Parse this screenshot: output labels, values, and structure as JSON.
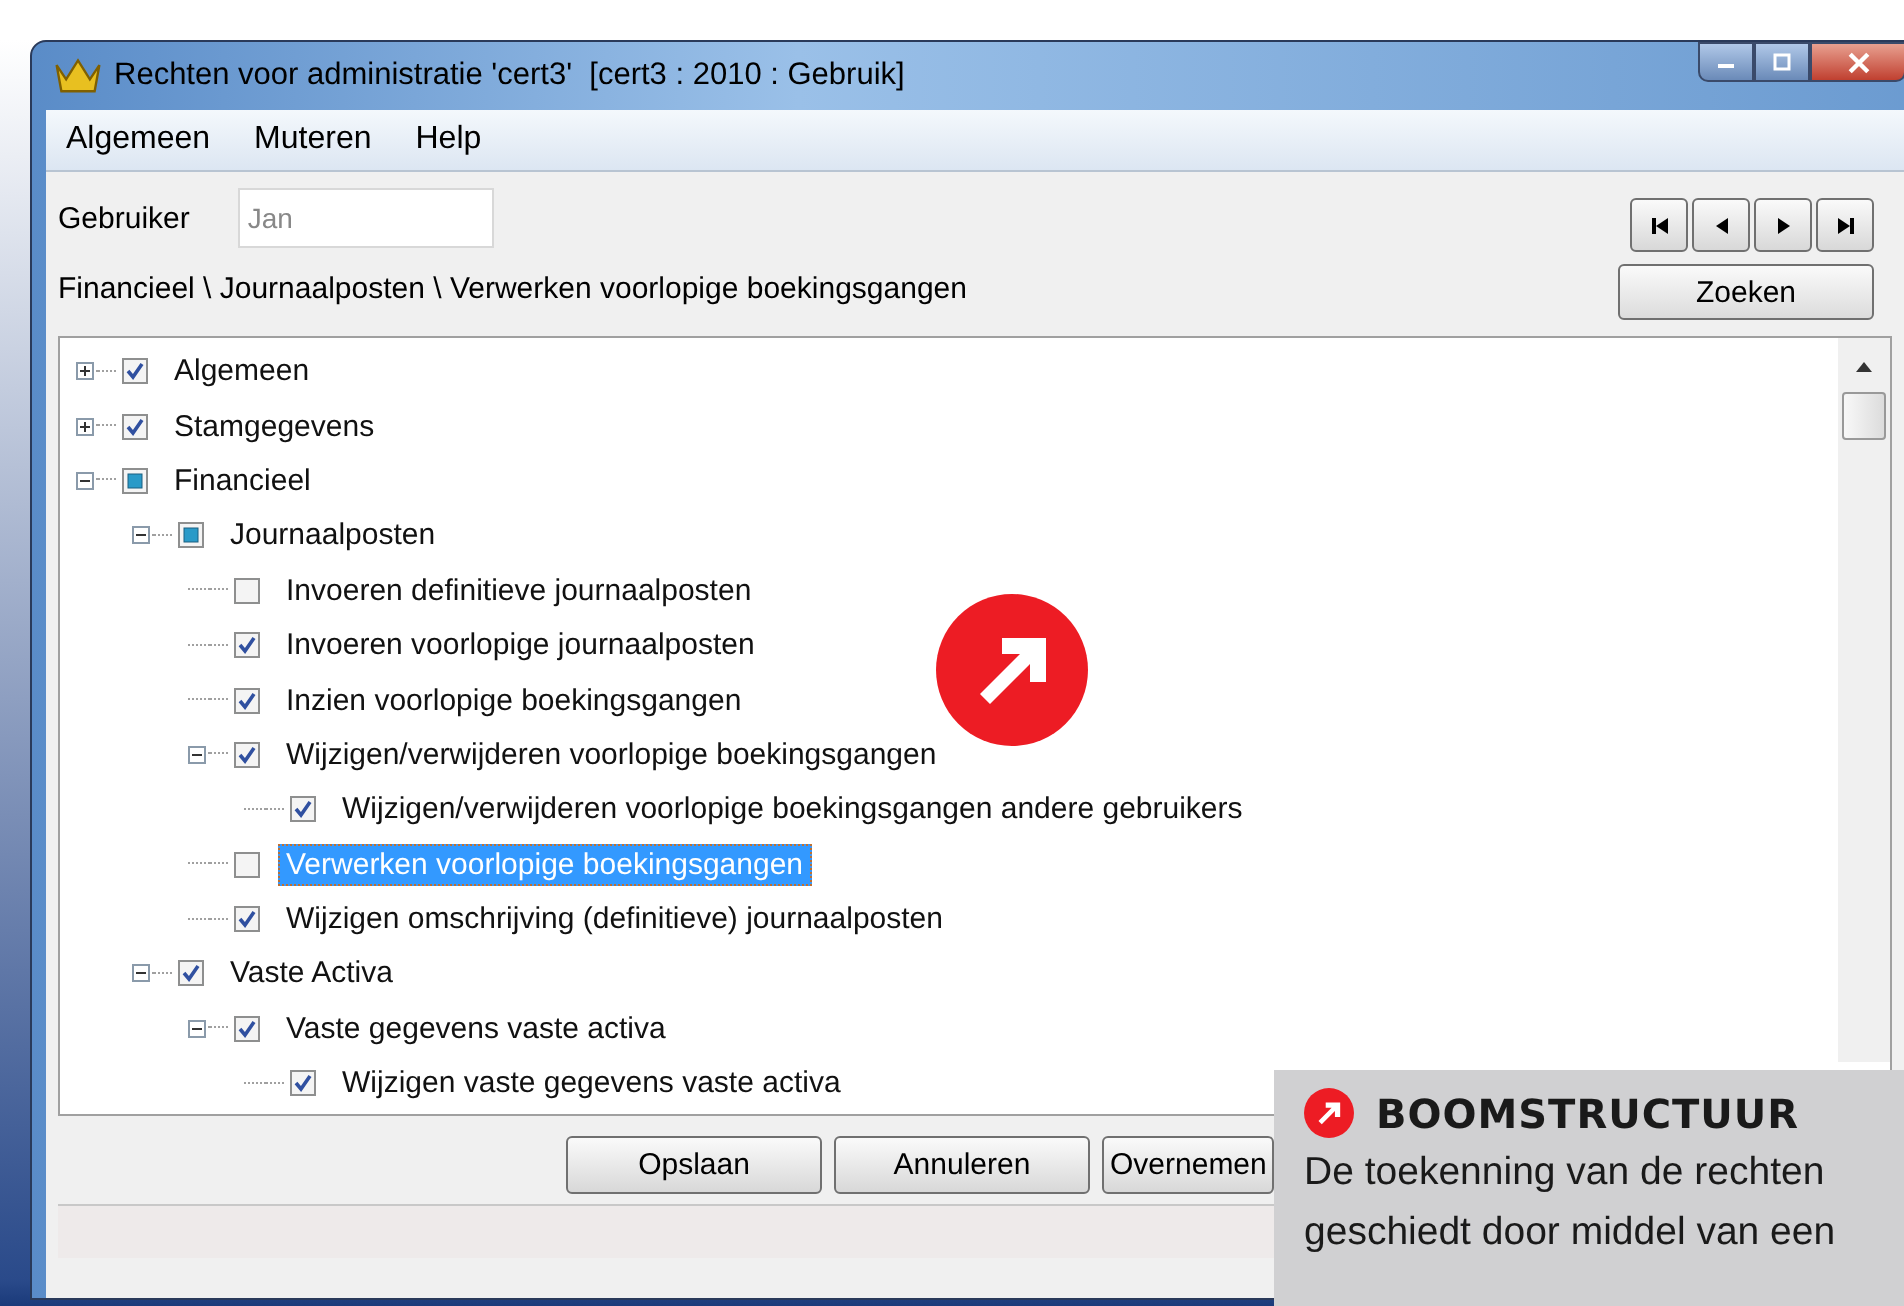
{
  "window": {
    "title": "Rechten voor administratie 'cert3'  [cert3 : 2010 : Gebruik]"
  },
  "menu": [
    "Algemeen",
    "Muteren",
    "Help"
  ],
  "user": {
    "label": "Gebruiker",
    "value": "Jan"
  },
  "breadcrumb": "Financieel \\ Journaalposten \\ Verwerken voorlopige boekingsgangen",
  "search_button": "Zoeken",
  "tree": [
    {
      "label": "Algemeen",
      "checked": true,
      "partial": false,
      "expanded": false,
      "selected": false
    },
    {
      "label": "Stamgegevens",
      "checked": true,
      "partial": false,
      "expanded": false,
      "selected": false
    },
    {
      "label": "Financieel",
      "checked": false,
      "partial": true,
      "expanded": true,
      "selected": false,
      "children": [
        {
          "label": "Journaalposten",
          "checked": false,
          "partial": true,
          "expanded": true,
          "selected": false,
          "children": [
            {
              "label": "Invoeren definitieve journaalposten",
              "checked": false,
              "partial": false,
              "selected": false
            },
            {
              "label": "Invoeren voorlopige journaalposten",
              "checked": true,
              "partial": false,
              "selected": false
            },
            {
              "label": "Inzien voorlopige boekingsgangen",
              "checked": true,
              "partial": false,
              "selected": false
            },
            {
              "label": "Wijzigen/verwijderen voorlopige boekingsgangen",
              "checked": true,
              "partial": false,
              "expanded": true,
              "selected": false,
              "children": [
                {
                  "label": "Wijzigen/verwijderen voorlopige boekingsgangen andere gebruikers",
                  "checked": true,
                  "partial": false,
                  "selected": false
                }
              ]
            },
            {
              "label": "Verwerken voorlopige boekingsgangen",
              "checked": false,
              "partial": false,
              "selected": true
            },
            {
              "label": "Wijzigen omschrijving (definitieve) journaalposten",
              "checked": true,
              "partial": false,
              "selected": false
            }
          ]
        },
        {
          "label": "Vaste Activa",
          "checked": true,
          "partial": false,
          "expanded": true,
          "selected": false,
          "children": [
            {
              "label": "Vaste gegevens vaste activa",
              "checked": true,
              "partial": false,
              "expanded": true,
              "selected": false,
              "children": [
                {
                  "label": "Wijzigen vaste gegevens vaste activa",
                  "checked": true,
                  "partial": false,
                  "selected": false
                }
              ]
            }
          ]
        }
      ]
    }
  ],
  "buttons": [
    "Opslaan",
    "Annuleren",
    "Overnemen"
  ],
  "callout": {
    "title": "BOOMSTRUCTUUR",
    "text": "De toekenning van de rechten geschiedt door middel van een"
  }
}
